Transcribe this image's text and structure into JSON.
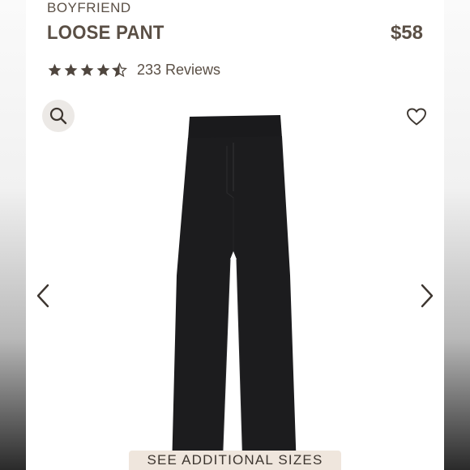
{
  "product": {
    "brand": "BOYFRIEND",
    "name": "LOOSE PANT",
    "price": "$58"
  },
  "rating": {
    "stars": 4.5,
    "reviews_label": "233 Reviews"
  },
  "actions": {
    "see_sizes_label": "SEE ADDITIONAL SIZES"
  },
  "icons": {
    "search": "search-icon",
    "favorite": "heart-icon",
    "previous": "chevron-left-icon",
    "next": "chevron-right-icon"
  },
  "colors": {
    "text": "#5a4f45",
    "star": "#4f463e",
    "button_bg": "#efe6dd",
    "search_bg": "#ece9e6",
    "product": "#1c1c1e"
  }
}
